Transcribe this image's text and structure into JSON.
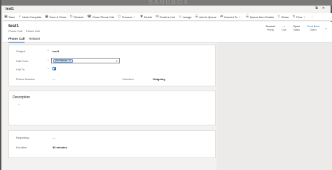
{
  "watermark": "SANDBOX",
  "window": {
    "title": "test1",
    "controls": [
      "⧉",
      "✕"
    ]
  },
  "toolbar": {
    "items": [
      {
        "icon": "save-icon",
        "glyph": "▣",
        "label": "Save"
      },
      {
        "icon": "check-icon",
        "glyph": "✓",
        "label": "Mark Complete"
      },
      {
        "icon": "save-close-icon",
        "glyph": "▣",
        "label": "Save & Close"
      },
      {
        "icon": "refresh-icon",
        "glyph": "↻",
        "label": "Refresh"
      },
      {
        "icon": "close-phone-call-icon",
        "glyph": "☎",
        "label": "Close Phone Call"
      },
      {
        "icon": "process-icon",
        "glyph": "⬡",
        "label": "Process",
        "dropdown": true
      },
      {
        "icon": "delete-icon",
        "glyph": "🗑",
        "label": "Delete"
      },
      {
        "icon": "email-link-icon",
        "glyph": "✉",
        "label": "Email a Link"
      },
      {
        "icon": "assign-icon",
        "glyph": "👤",
        "label": "Assign"
      },
      {
        "icon": "add-queue-icon",
        "glyph": "☰",
        "label": "Add to Queue"
      },
      {
        "icon": "convert-to-icon",
        "glyph": "⇄",
        "label": "Convert To",
        "dropdown": true
      },
      {
        "icon": "queue-item-details-icon",
        "glyph": "☰",
        "label": "Queue Item Details"
      },
      {
        "icon": "share-icon",
        "glyph": "⇪",
        "label": "Share"
      },
      {
        "icon": "flow-icon",
        "glyph": "↯",
        "label": "Flow",
        "dropdown": true
      }
    ],
    "more": "⋮"
  },
  "header": {
    "title": "test1",
    "entity": "Phone Call",
    "separator": "·",
    "form": "Phone Call",
    "fields": [
      {
        "value": "Normal",
        "label": "Priority"
      },
      {
        "value": "---",
        "label": "Due"
      },
      {
        "value": "Open",
        "label": "Status"
      },
      {
        "value": "Crmi Bom",
        "label": "Owner",
        "link": true
      }
    ]
  },
  "tabs": [
    "Phone Call",
    "Related"
  ],
  "form": {
    "subject": {
      "label": "Subject",
      "value": "test1"
    },
    "call_from": {
      "label": "Call From",
      "chip": "(No Name)"
    },
    "call_to": {
      "label": "Call To"
    },
    "phone_number": {
      "label": "Phone Number",
      "value": "---"
    },
    "direction": {
      "label": "Direction",
      "value": "Outgoing"
    },
    "description": {
      "label": "Description",
      "value": "---"
    },
    "regarding": {
      "label": "Regarding",
      "value": "---"
    },
    "duration": {
      "label": "Duration",
      "value": "30 minutes"
    }
  },
  "colors": {
    "accent": "#0f6cbd",
    "chip_bg": "#c7e0f4",
    "required": "#a4262c"
  }
}
